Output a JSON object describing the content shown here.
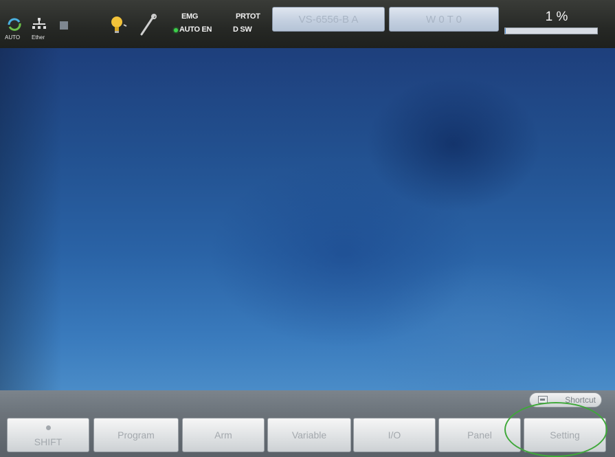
{
  "status_bar": {
    "auto_label": "AUTO",
    "ether_label": "Ether",
    "emg": "EMG",
    "auto_en": "AUTO EN",
    "prtot": "PRTOT",
    "dsw": "D SW",
    "robot_model": "VS-6556-B A",
    "work_tool": "W 0 T 0",
    "speed_text": "1 %",
    "speed_percent": 1,
    "led_color": "#3cd04a",
    "icons": [
      "auto-mode-icon",
      "ethernet-icon",
      "stop-square-icon",
      "lightbulb-icon",
      "wrench-icon"
    ]
  },
  "shortcut": {
    "label": "Shortcut"
  },
  "tabs": [
    {
      "id": "shift",
      "label": "SHIFT"
    },
    {
      "id": "program",
      "label": "Program"
    },
    {
      "id": "arm",
      "label": "Arm"
    },
    {
      "id": "variable",
      "label": "Variable"
    },
    {
      "id": "io",
      "label": "I/O"
    },
    {
      "id": "panel",
      "label": "Panel"
    },
    {
      "id": "setting",
      "label": "Setting"
    }
  ],
  "colors": {
    "screen_blue": "#2a63a6",
    "annotation_circle": "#3fa83a"
  }
}
